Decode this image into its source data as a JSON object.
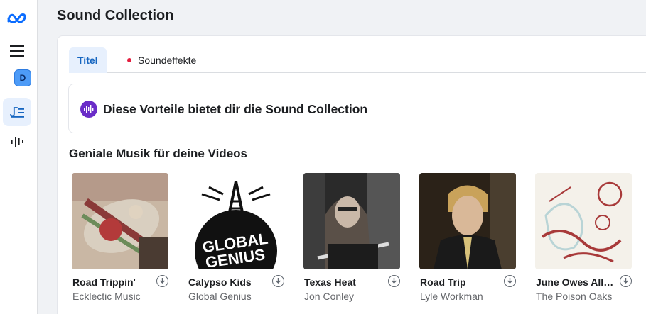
{
  "app": {
    "icons": {
      "logo": "meta-logo-icon",
      "menu": "hamburger-menu-icon",
      "music": "music-list-icon",
      "audio": "audio-wave-icon",
      "benefits": "audio-wave-icon",
      "download": "download-icon"
    },
    "avatar_letter": "D"
  },
  "page": {
    "title": "Sound Collection"
  },
  "tabs": [
    {
      "label": "Titel",
      "active": true
    },
    {
      "label": "Soundeffekte",
      "active": false
    }
  ],
  "benefits": {
    "text": "Diese Vorteile bietet dir die Sound Collection"
  },
  "section": {
    "title": "Geniale Musik für deine Videos"
  },
  "tracks": [
    {
      "title": "Road Trippin'",
      "artist": "Ecklectic Music"
    },
    {
      "title": "Calypso Kids",
      "artist": "Global Genius",
      "cover_text": [
        "GLOBAL",
        "GENIUS"
      ]
    },
    {
      "title": "Texas Heat",
      "artist": "Jon Conley"
    },
    {
      "title": "Road Trip",
      "artist": "Lyle Workman"
    },
    {
      "title": "June Owes All ...",
      "artist": "The Poison Oaks"
    }
  ],
  "colors": {
    "accent": "#1565c0",
    "tab_active_bg": "#e7f0fd",
    "purple_icon": "#6a2cc8",
    "red_dot": "#e41e3f"
  }
}
